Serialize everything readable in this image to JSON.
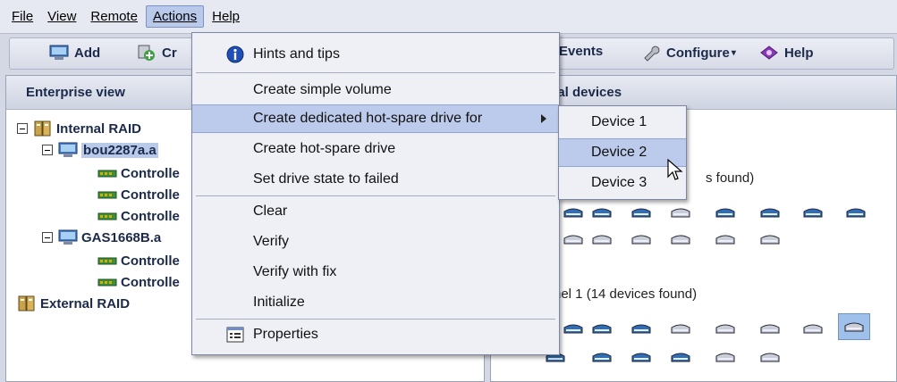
{
  "menubar": {
    "items": [
      {
        "label": "File",
        "active": false
      },
      {
        "label": "View",
        "active": false
      },
      {
        "label": "Remote",
        "active": false
      },
      {
        "label": "Actions",
        "active": true
      },
      {
        "label": "Help",
        "active": false
      }
    ]
  },
  "toolbar": {
    "add_label": "Add",
    "create_label": "Cr",
    "events_label": "Events",
    "configure_label": "Configure",
    "help_label": "Help"
  },
  "left_panel": {
    "title": "Enterprise view",
    "tree": [
      {
        "label": "Internal RAID",
        "icon": "raid-icon"
      },
      {
        "label": "bou2287a.a",
        "icon": "server-icon"
      },
      {
        "label": "Controlle",
        "icon": "controller-icon"
      },
      {
        "label": "Controlle",
        "icon": "controller-icon"
      },
      {
        "label": "Controlle",
        "icon": "controller-icon"
      },
      {
        "label": "GAS1668B.a",
        "icon": "server-icon"
      },
      {
        "label": "Controlle",
        "icon": "controller-icon"
      },
      {
        "label": "Controlle",
        "icon": "controller-icon"
      },
      {
        "label": "External RAID",
        "icon": "raid-icon"
      }
    ]
  },
  "right_panel": {
    "title": "cal devices",
    "channel0_label": "s found)",
    "channel1_label": "nel 1   (14 devices found)"
  },
  "actions_menu": {
    "items": [
      {
        "label": "Hints and tips",
        "icon": "info-icon"
      },
      {
        "label": "Create simple volume"
      },
      {
        "label": "Create dedicated hot-spare drive for",
        "has_submenu": true
      },
      {
        "label": "Create hot-spare drive"
      },
      {
        "label": "Set drive state to failed"
      },
      {
        "label": "Clear"
      },
      {
        "label": "Verify"
      },
      {
        "label": "Verify with fix"
      },
      {
        "label": "Initialize"
      },
      {
        "label": "Properties",
        "icon": "properties-icon"
      }
    ]
  },
  "submenu": {
    "items": [
      {
        "label": "Device 1"
      },
      {
        "label": "Device 2"
      },
      {
        "label": "Device 3"
      }
    ]
  },
  "colors": {
    "highlight": "#bccbeb",
    "menu_bg": "#eef0f6",
    "drive_blue": "#2f6fb5",
    "drive_grey": "#c9ced6"
  }
}
